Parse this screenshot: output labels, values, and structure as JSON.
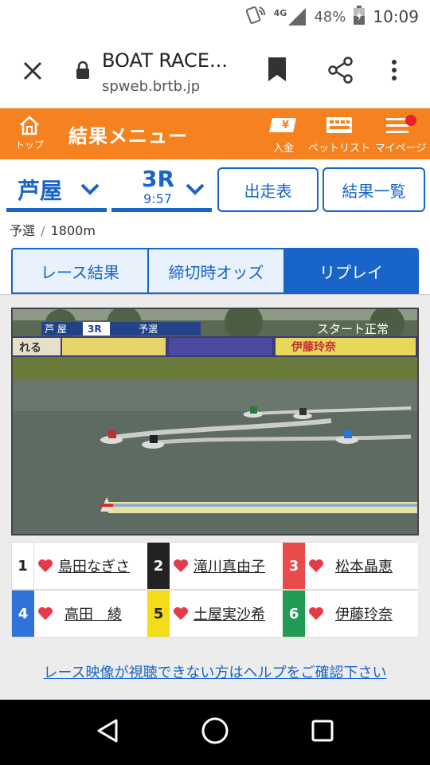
{
  "status_bar": {
    "network": "4G",
    "battery": "48%",
    "time": "10:09"
  },
  "browser": {
    "page_title": "BOAT RACE...",
    "url": "spweb.brtb.jp"
  },
  "header": {
    "home_label": "トップ",
    "menu_title": "結果メニュー",
    "deposit_label": "入金",
    "betlist_label": "ベットリスト",
    "mypage_label": "マイページ"
  },
  "race_select": {
    "venue": "芦屋",
    "race_number": "3R",
    "race_time": "9:57",
    "race_card_button": "出走表",
    "results_list_button": "結果一覧"
  },
  "race_info": {
    "race_type": "予選",
    "separator": "/",
    "distance": "1800m"
  },
  "tabs": [
    {
      "label": "レース結果",
      "active": false
    },
    {
      "label": "締切時オッズ",
      "active": false
    },
    {
      "label": "リプレイ",
      "active": true
    }
  ],
  "video": {
    "overlay_venue": "芦 屋",
    "overlay_race": "3R",
    "overlay_type": "予選",
    "status_text": "スタート正常",
    "banner_text_1": "れる",
    "banner_text_2": "伊藤玲奈"
  },
  "racers": [
    {
      "number": "1",
      "name": "島田なぎさ",
      "color": "#ffffff"
    },
    {
      "number": "2",
      "name": "滝川真由子",
      "color": "#222222"
    },
    {
      "number": "3",
      "name": "松本晶恵",
      "color": "#e94a4a"
    },
    {
      "number": "4",
      "name": "高田　綾",
      "color": "#2e74d8"
    },
    {
      "number": "5",
      "name": "土屋実沙希",
      "color": "#f4dc18"
    },
    {
      "number": "6",
      "name": "伊藤玲奈",
      "color": "#1f9b54"
    }
  ],
  "help_link": "レース映像が視聴できない方はヘルプをご確認下さい",
  "colors": {
    "accent_orange": "#f5821f",
    "accent_blue": "#1864c8"
  }
}
